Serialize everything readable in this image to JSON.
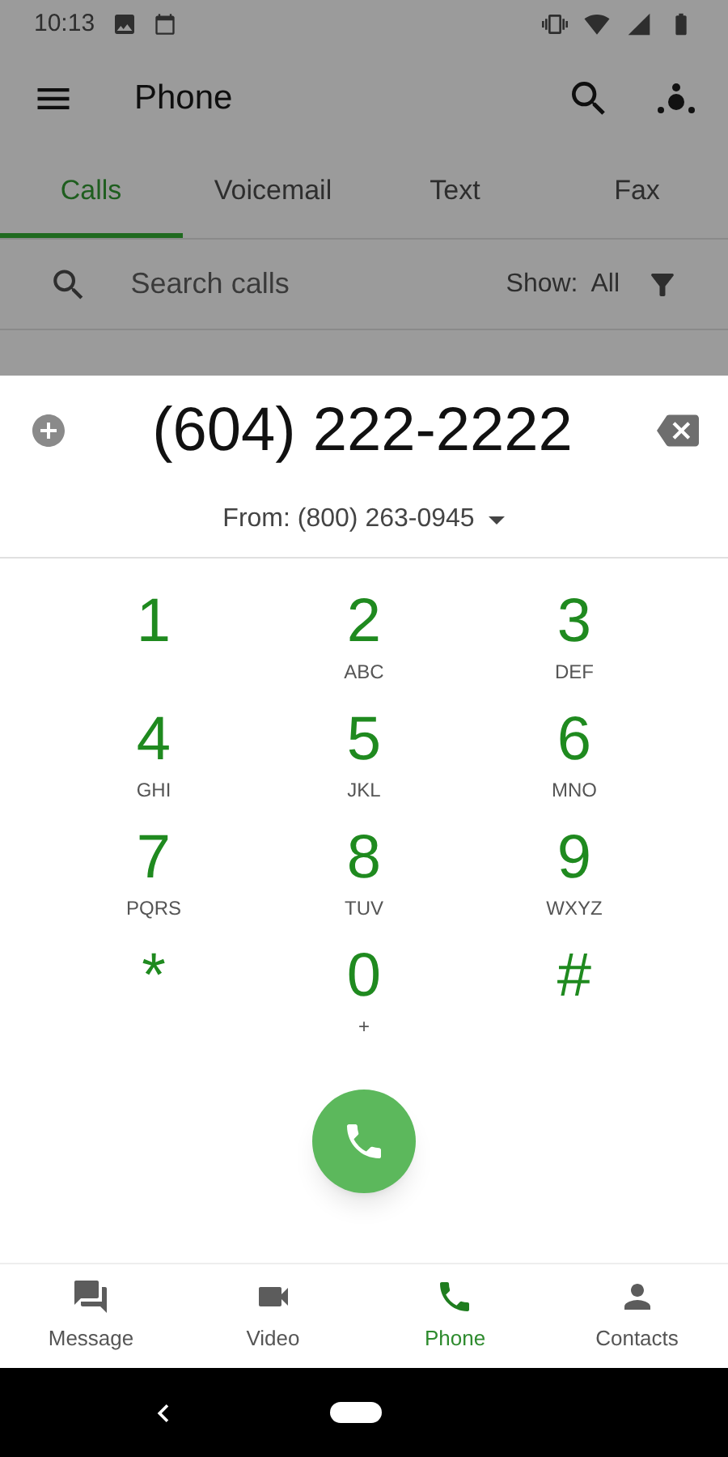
{
  "status_bar": {
    "time": "10:13"
  },
  "app_bar": {
    "title": "Phone"
  },
  "tabs": [
    {
      "label": "Calls",
      "selected": true
    },
    {
      "label": "Voicemail",
      "selected": false
    },
    {
      "label": "Text",
      "selected": false
    },
    {
      "label": "Fax",
      "selected": false
    }
  ],
  "search": {
    "placeholder": "Search calls",
    "show_label": "Show:",
    "show_value": "All"
  },
  "dialer": {
    "number": "(604) 222-2222",
    "from": "From: (800) 263-0945"
  },
  "keys": [
    {
      "digit": "1"
    },
    {
      "digit": "2",
      "letters": "ABC"
    },
    {
      "digit": "3",
      "letters": "DEF"
    },
    {
      "digit": "4",
      "letters": "GHI"
    },
    {
      "digit": "5",
      "letters": "JKL"
    },
    {
      "digit": "6",
      "letters": "MNO"
    },
    {
      "digit": "7",
      "letters": "PQRS"
    },
    {
      "digit": "8",
      "letters": "TUV"
    },
    {
      "digit": "9",
      "letters": "WXYZ"
    },
    {
      "digit": "*"
    },
    {
      "digit": "0",
      "letters": "+"
    },
    {
      "digit": "#"
    }
  ],
  "bottom_nav": [
    {
      "kind": "message",
      "label": "Message",
      "selected": false
    },
    {
      "kind": "video",
      "label": "Video",
      "selected": false
    },
    {
      "kind": "phone",
      "label": "Phone",
      "selected": true
    },
    {
      "kind": "contacts",
      "label": "Contacts",
      "selected": false
    }
  ]
}
